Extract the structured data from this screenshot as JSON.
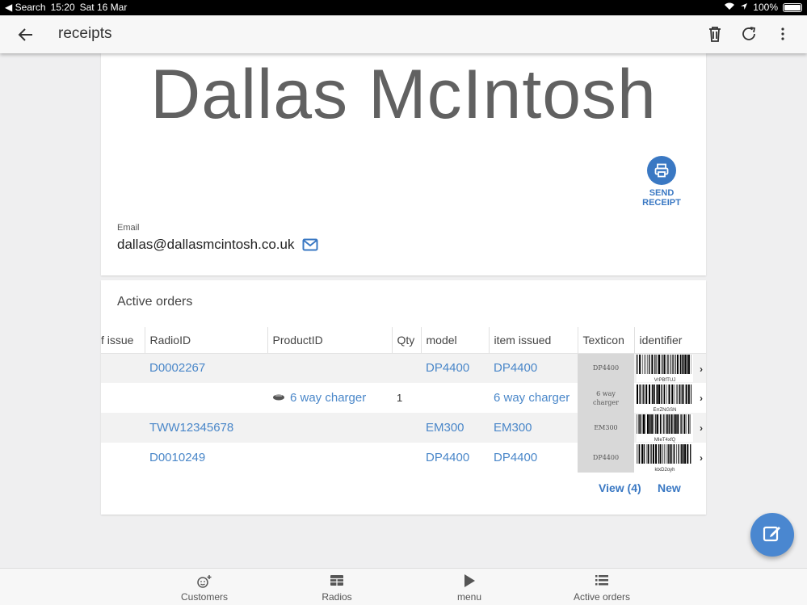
{
  "status_bar": {
    "back_app": "Search",
    "time": "15:20",
    "date": "Sat 16 Mar",
    "battery": "100%"
  },
  "app_bar": {
    "title": "receipts"
  },
  "customer": {
    "name": "Dallas McIntosh",
    "send_receipt_label": "SEND RECEIPT",
    "email_label": "Email",
    "email": "dallas@dallasmcintosh.co.uk"
  },
  "orders": {
    "title": "Active orders",
    "columns": [
      "f issue",
      "RadioID",
      "ProductID",
      "Qty",
      "model",
      "item issued",
      "Texticon",
      "identifier"
    ],
    "rows": [
      {
        "issue": "",
        "radio_id": "D0002267",
        "product_id": "",
        "qty": "",
        "model": "DP4400",
        "item_issued": "DP4400",
        "texticon": "DP4400",
        "barcode_code": "VrPBfTUJ"
      },
      {
        "issue": "",
        "radio_id": "",
        "product_id": "6 way charger",
        "qty": "1",
        "model": "",
        "item_issued": "6 way charger",
        "texticon": "6 way charger",
        "barcode_code": "ErrZNGSN"
      },
      {
        "issue": "",
        "radio_id": "TWW12345678",
        "product_id": "",
        "qty": "",
        "model": "EM300",
        "item_issued": "EM300",
        "texticon": "EM300",
        "barcode_code": "MIeT4xfQ"
      },
      {
        "issue": "",
        "radio_id": "D0010249",
        "product_id": "",
        "qty": "",
        "model": "DP4400",
        "item_issued": "DP4400",
        "texticon": "DP4400",
        "barcode_code": "ktxD2oyh"
      }
    ],
    "view_label": "View (4)",
    "new_label": "New"
  },
  "bottom_nav": [
    {
      "label": "Customers",
      "icon": "customers-icon"
    },
    {
      "label": "Radios",
      "icon": "radios-icon"
    },
    {
      "label": "menu",
      "icon": "play-icon"
    },
    {
      "label": "Active orders",
      "icon": "list-icon"
    }
  ],
  "colors": {
    "accent": "#3a78c3",
    "link": "#4a87c9",
    "fab": "#4a87d0"
  }
}
